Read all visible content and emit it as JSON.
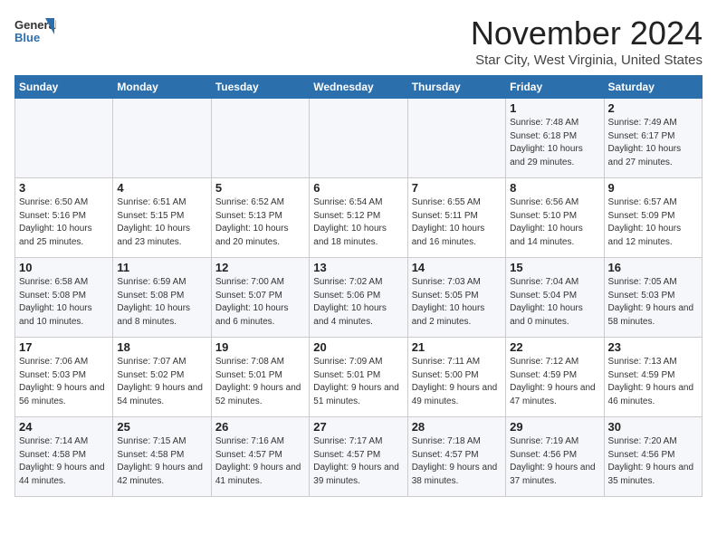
{
  "header": {
    "logo": {
      "general": "General",
      "blue": "Blue"
    },
    "title": "November 2024",
    "location": "Star City, West Virginia, United States"
  },
  "calendar": {
    "days_of_week": [
      "Sunday",
      "Monday",
      "Tuesday",
      "Wednesday",
      "Thursday",
      "Friday",
      "Saturday"
    ],
    "weeks": [
      [
        {
          "day": "",
          "info": ""
        },
        {
          "day": "",
          "info": ""
        },
        {
          "day": "",
          "info": ""
        },
        {
          "day": "",
          "info": ""
        },
        {
          "day": "",
          "info": ""
        },
        {
          "day": "1",
          "info": "Sunrise: 7:48 AM\nSunset: 6:18 PM\nDaylight: 10 hours and 29 minutes."
        },
        {
          "day": "2",
          "info": "Sunrise: 7:49 AM\nSunset: 6:17 PM\nDaylight: 10 hours and 27 minutes."
        }
      ],
      [
        {
          "day": "3",
          "info": "Sunrise: 6:50 AM\nSunset: 5:16 PM\nDaylight: 10 hours and 25 minutes."
        },
        {
          "day": "4",
          "info": "Sunrise: 6:51 AM\nSunset: 5:15 PM\nDaylight: 10 hours and 23 minutes."
        },
        {
          "day": "5",
          "info": "Sunrise: 6:52 AM\nSunset: 5:13 PM\nDaylight: 10 hours and 20 minutes."
        },
        {
          "day": "6",
          "info": "Sunrise: 6:54 AM\nSunset: 5:12 PM\nDaylight: 10 hours and 18 minutes."
        },
        {
          "day": "7",
          "info": "Sunrise: 6:55 AM\nSunset: 5:11 PM\nDaylight: 10 hours and 16 minutes."
        },
        {
          "day": "8",
          "info": "Sunrise: 6:56 AM\nSunset: 5:10 PM\nDaylight: 10 hours and 14 minutes."
        },
        {
          "day": "9",
          "info": "Sunrise: 6:57 AM\nSunset: 5:09 PM\nDaylight: 10 hours and 12 minutes."
        }
      ],
      [
        {
          "day": "10",
          "info": "Sunrise: 6:58 AM\nSunset: 5:08 PM\nDaylight: 10 hours and 10 minutes."
        },
        {
          "day": "11",
          "info": "Sunrise: 6:59 AM\nSunset: 5:08 PM\nDaylight: 10 hours and 8 minutes."
        },
        {
          "day": "12",
          "info": "Sunrise: 7:00 AM\nSunset: 5:07 PM\nDaylight: 10 hours and 6 minutes."
        },
        {
          "day": "13",
          "info": "Sunrise: 7:02 AM\nSunset: 5:06 PM\nDaylight: 10 hours and 4 minutes."
        },
        {
          "day": "14",
          "info": "Sunrise: 7:03 AM\nSunset: 5:05 PM\nDaylight: 10 hours and 2 minutes."
        },
        {
          "day": "15",
          "info": "Sunrise: 7:04 AM\nSunset: 5:04 PM\nDaylight: 10 hours and 0 minutes."
        },
        {
          "day": "16",
          "info": "Sunrise: 7:05 AM\nSunset: 5:03 PM\nDaylight: 9 hours and 58 minutes."
        }
      ],
      [
        {
          "day": "17",
          "info": "Sunrise: 7:06 AM\nSunset: 5:03 PM\nDaylight: 9 hours and 56 minutes."
        },
        {
          "day": "18",
          "info": "Sunrise: 7:07 AM\nSunset: 5:02 PM\nDaylight: 9 hours and 54 minutes."
        },
        {
          "day": "19",
          "info": "Sunrise: 7:08 AM\nSunset: 5:01 PM\nDaylight: 9 hours and 52 minutes."
        },
        {
          "day": "20",
          "info": "Sunrise: 7:09 AM\nSunset: 5:01 PM\nDaylight: 9 hours and 51 minutes."
        },
        {
          "day": "21",
          "info": "Sunrise: 7:11 AM\nSunset: 5:00 PM\nDaylight: 9 hours and 49 minutes."
        },
        {
          "day": "22",
          "info": "Sunrise: 7:12 AM\nSunset: 4:59 PM\nDaylight: 9 hours and 47 minutes."
        },
        {
          "day": "23",
          "info": "Sunrise: 7:13 AM\nSunset: 4:59 PM\nDaylight: 9 hours and 46 minutes."
        }
      ],
      [
        {
          "day": "24",
          "info": "Sunrise: 7:14 AM\nSunset: 4:58 PM\nDaylight: 9 hours and 44 minutes."
        },
        {
          "day": "25",
          "info": "Sunrise: 7:15 AM\nSunset: 4:58 PM\nDaylight: 9 hours and 42 minutes."
        },
        {
          "day": "26",
          "info": "Sunrise: 7:16 AM\nSunset: 4:57 PM\nDaylight: 9 hours and 41 minutes."
        },
        {
          "day": "27",
          "info": "Sunrise: 7:17 AM\nSunset: 4:57 PM\nDaylight: 9 hours and 39 minutes."
        },
        {
          "day": "28",
          "info": "Sunrise: 7:18 AM\nSunset: 4:57 PM\nDaylight: 9 hours and 38 minutes."
        },
        {
          "day": "29",
          "info": "Sunrise: 7:19 AM\nSunset: 4:56 PM\nDaylight: 9 hours and 37 minutes."
        },
        {
          "day": "30",
          "info": "Sunrise: 7:20 AM\nSunset: 4:56 PM\nDaylight: 9 hours and 35 minutes."
        }
      ]
    ]
  }
}
